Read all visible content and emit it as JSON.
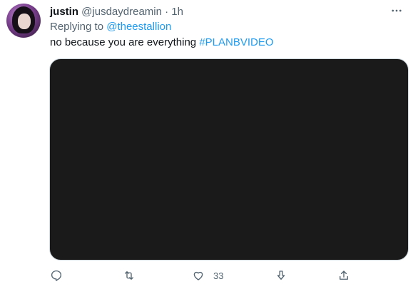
{
  "tweet": {
    "display_name": "justin",
    "handle": "@jusdaydreamin",
    "separator": "·",
    "time": "1h",
    "more_icon": "more-horizontal-icon",
    "replying_label": "Replying to",
    "replying_to": "@theestallion",
    "text": "no because you are everything",
    "hashtag": "#PLANBVIDEO"
  },
  "actions": {
    "like_count": "33"
  },
  "colors": {
    "link": "#1d9bf0",
    "muted": "#536471",
    "text": "#0f1419"
  }
}
